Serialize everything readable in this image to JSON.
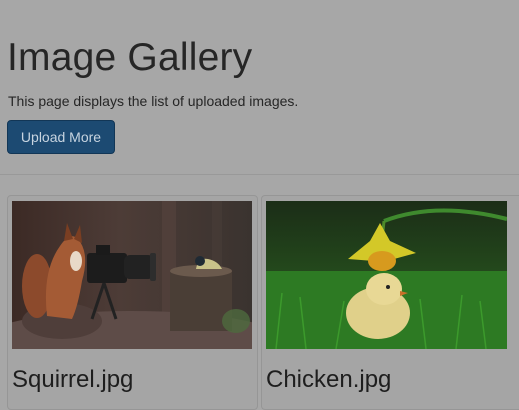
{
  "header": {
    "title": "Image Gallery",
    "description": "This page displays the list of uploaded images.",
    "upload_label": "Upload More"
  },
  "gallery": [
    {
      "name": "Squirrel.jpg"
    },
    {
      "name": "Chicken.jpg"
    }
  ]
}
